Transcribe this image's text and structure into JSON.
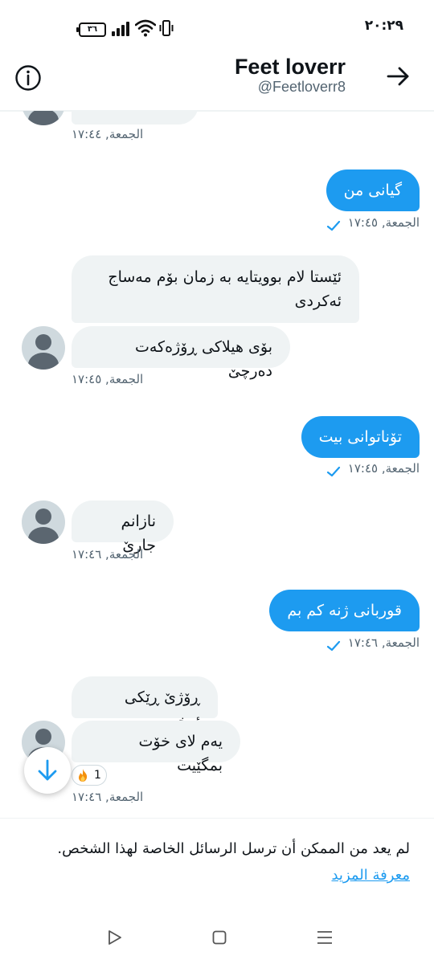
{
  "status_bar": {
    "time": "٢٠:٢٩",
    "battery": "٣٦"
  },
  "header": {
    "name": "Feet loverr",
    "handle": "@Feetloverr8"
  },
  "messages": [
    {
      "meta": "الجمعة, ١٧:٤٤"
    },
    {
      "text": "گیانی من",
      "meta": "الجمعة, ١٧:٤٥"
    },
    {
      "text1": "ئێستا لام بوویتایە بە زمان بۆم مەساج",
      "text2": "ئەکردی",
      "text3": "بۆی هیلاکی ڕۆژەکەت دەرچێ",
      "meta": "الجمعة, ١٧:٤٥"
    },
    {
      "text": "تۆناتوانی بیت",
      "meta": "الجمعة, ١٧:٤٥"
    },
    {
      "text": "نازانم جارێ",
      "meta": "الجمعة, ١٧:٤٦"
    },
    {
      "text": "قوربانی ژنە کم بم",
      "meta": "الجمعة, ١٧:٤٦"
    },
    {
      "text1": "ڕۆژێ ڕێکی ئەخەم",
      "text2": "یەم لای خۆت بمگێیت",
      "reaction_count": "1",
      "meta": "الجمعة, ١٧:٤٦"
    }
  ],
  "footer": {
    "text": "لم يعد من الممكن أن ترسل الرسائل الخاصة لهذا الشخص.",
    "link": "معرفة المزيد"
  },
  "colors": {
    "accent": "#1d9bf0",
    "bubble_in": "#eff3f4"
  },
  "icons": [
    "info-icon",
    "arrow-right-icon",
    "arrow-down-icon",
    "fire-emoji-icon",
    "checkmark-icon",
    "nav-back-icon",
    "nav-home-icon",
    "nav-menu-icon"
  ]
}
